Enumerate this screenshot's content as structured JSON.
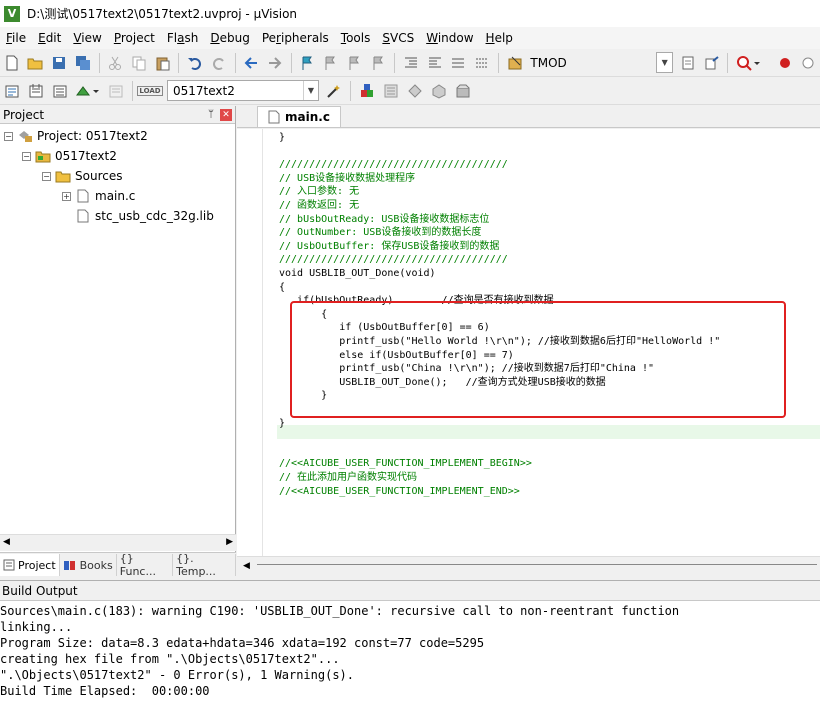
{
  "window": {
    "title": "D:\\测试\\0517text2\\0517text2.uvproj - µVision"
  },
  "menu": [
    {
      "pre": "",
      "ul": "F",
      "post": "ile"
    },
    {
      "pre": "",
      "ul": "E",
      "post": "dit"
    },
    {
      "pre": "",
      "ul": "V",
      "post": "iew"
    },
    {
      "pre": "",
      "ul": "P",
      "post": "roject"
    },
    {
      "pre": "Fl",
      "ul": "a",
      "post": "sh"
    },
    {
      "pre": "",
      "ul": "D",
      "post": "ebug"
    },
    {
      "pre": "Pe",
      "ul": "r",
      "post": "ipherals"
    },
    {
      "pre": "",
      "ul": "T",
      "post": "ools"
    },
    {
      "pre": "",
      "ul": "S",
      "post": "VCS"
    },
    {
      "pre": "",
      "ul": "W",
      "post": "indow"
    },
    {
      "pre": "",
      "ul": "H",
      "post": "elp"
    }
  ],
  "toolbar": {
    "search_value": "TMOD",
    "target_value": "0517text2",
    "load_label": "LOAD"
  },
  "project": {
    "panel_title": "Project",
    "root": "Project: 0517text2",
    "target": "0517text2",
    "group": "Sources",
    "files": [
      "main.c",
      "stc_usb_cdc_32g.lib"
    ],
    "tabs": [
      "Project",
      "Books",
      "{} Func...",
      "{}. Temp..."
    ]
  },
  "editor": {
    "tab": "main.c",
    "lines": [
      "}",
      "",
      "//////////////////////////////////////",
      "// USB设备接收数据处理程序",
      "// 入口参数: 无",
      "// 函数返回: 无",
      "// bUsbOutReady: USB设备接收数据标志位",
      "// OutNumber: USB设备接收到的数据长度",
      "// UsbOutBuffer: 保存USB设备接收到的数据",
      "//////////////////////////////////////",
      "void USBLIB_OUT_Done(void)",
      "{",
      "   if(bUsbOutReady)        //查询是否有接收到数据",
      "       {",
      "          if (UsbOutBuffer[0] == 6)",
      "          printf_usb(\"Hello World !\\r\\n\"); //接收到数据6后打印\"HelloWorld !\"",
      "          else if(UsbOutBuffer[0] == 7)",
      "          printf_usb(\"China !\\r\\n\"); //接收到数据7后打印\"China !\"",
      "          USBLIB_OUT_Done();   //查询方式处理USB接收的数据",
      "       }",
      "",
      "}",
      "",
      "",
      "//<<AICUBE_USER_FUNCTION_IMPLEMENT_BEGIN>>",
      "// 在此添加用户函数实现代码",
      "//<<AICUBE_USER_FUNCTION_IMPLEMENT_END>>"
    ]
  },
  "build": {
    "title": "Build Output",
    "lines": [
      "Sources\\main.c(183): warning C190: 'USBLIB_OUT_Done': recursive call to non-reentrant function",
      "linking...",
      "Program Size: data=8.3 edata+hdata=346 xdata=192 const=77 code=5295",
      "creating hex file from \".\\Objects\\0517text2\"...",
      "\".\\Objects\\0517text2\" - 0 Error(s), 1 Warning(s).",
      "Build Time Elapsed:  00:00:00"
    ]
  },
  "colors": {
    "comment": "#008000",
    "highlight_box": "#e02020",
    "current_line": "#e8f8e8"
  }
}
